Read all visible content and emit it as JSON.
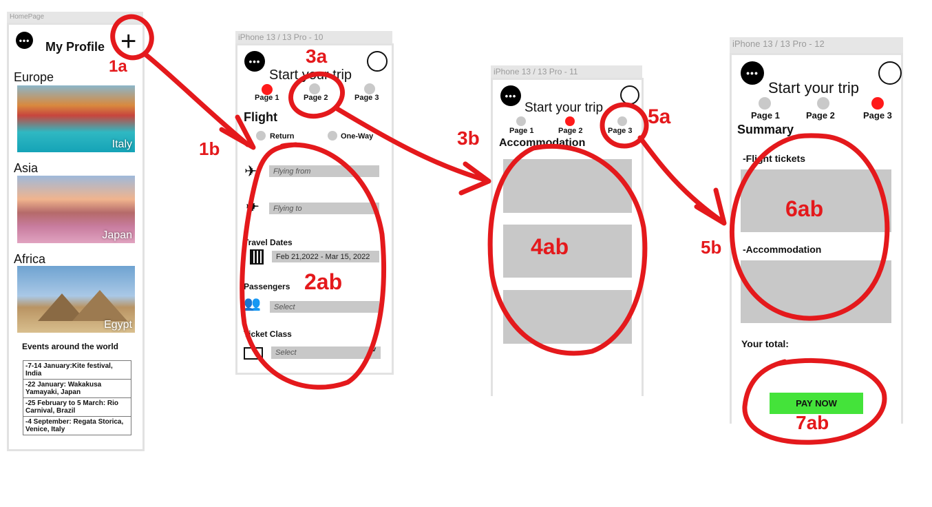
{
  "home": {
    "artboard_label": "HomePage",
    "title": "My Profile",
    "regions": [
      {
        "name": "Europe",
        "photo_label": "Italy"
      },
      {
        "name": "Asia",
        "photo_label": "Japan"
      },
      {
        "name": "Africa",
        "photo_label": "Egypt"
      }
    ],
    "events_title": "Events around the world",
    "events": [
      "-7-14 January:Kite festival, India",
      "-22 January: Wakakusa Yamayaki, Japan",
      "-25 February  to 5 March: Rio Carnival, Brazil",
      "-4 September: Regata Storica, Venice, Italy"
    ]
  },
  "screen10": {
    "artboard_label": "iPhone 13 / 13 Pro - 10",
    "title": "Start your trip",
    "pages": [
      "Page 1",
      "Page 2",
      "Page 3"
    ],
    "flight_heading": "Flight",
    "return_label": "Return",
    "oneway_label": "One-Way",
    "flying_from": "Flying from",
    "flying_to": "Flying to",
    "travel_dates_heading": "Travel Dates",
    "dates_value": "Feb 21,2022 - Mar 15, 2022",
    "passengers_heading": "Passengers",
    "passengers_value": "Select",
    "ticket_class_heading": "Ticket Class",
    "ticket_class_value": "Select"
  },
  "screen11": {
    "artboard_label": "iPhone 13 / 13 Pro - 11",
    "title": "Start your trip",
    "pages": [
      "Page 1",
      "Page 2",
      "Page 3"
    ],
    "heading": "Accommodation"
  },
  "screen12": {
    "artboard_label": "iPhone 13 / 13 Pro - 12",
    "title": "Start your trip",
    "pages": [
      "Page 1",
      "Page 2",
      "Page 3"
    ],
    "summary_heading": "Summary",
    "flight_tickets": "-Flight tickets",
    "accommodation": "-Accommodation",
    "total_label": "Your total:",
    "pay_button": "PAY NOW"
  },
  "annotations": {
    "a1a": "1a",
    "a1b": "1b",
    "a2ab": "2ab",
    "a3a": "3a",
    "a3b": "3b",
    "a4ab": "4ab",
    "a5a": "5a",
    "a5b": "5b",
    "a6ab": "6ab",
    "a7ab": "7ab"
  },
  "colors": {
    "annotation_red": "#e4191c",
    "active_dot": "#ff1a1a",
    "inactive_dot": "#c9c9c9",
    "placeholder_gray": "#c8c8c8",
    "pay_button_green": "#44e33a"
  },
  "icons": {
    "menu": "more-dots-icon",
    "add": "plus-icon",
    "profile": "user-avatar-icon",
    "departure": "plane-departure-icon",
    "arrival": "plane-icon",
    "calendar": "calendar-icon",
    "passengers": "people-icon",
    "ticket": "ticket-icon",
    "dropdown": "chevron-down-icon"
  }
}
